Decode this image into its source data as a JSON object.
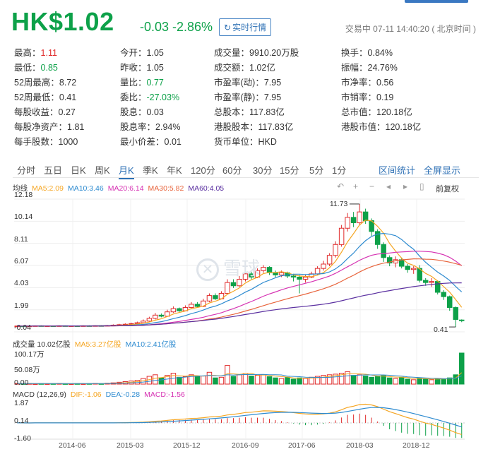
{
  "header": {
    "price": "HK$1.02",
    "change": "-0.03 -2.86%",
    "realtime_button": "实时行情",
    "realtime_icon": "refresh-icon",
    "trade_status": "交易中 07-11 14:40:20 ( 北京时间 )"
  },
  "stats": [
    [
      {
        "label": "最高：",
        "value": "1.11",
        "color": "red"
      },
      {
        "label": "今开：",
        "value": "1.05"
      },
      {
        "label": "成交量：",
        "value": "9910.20万股"
      },
      {
        "label": "换手：",
        "value": "0.84%"
      }
    ],
    [
      {
        "label": "最低：",
        "value": "0.85",
        "color": "green"
      },
      {
        "label": "昨收：",
        "value": "1.05"
      },
      {
        "label": "成交额：",
        "value": "1.02亿"
      },
      {
        "label": "振幅：",
        "value": "24.76%"
      }
    ],
    [
      {
        "label": "52周最高：",
        "value": "8.72"
      },
      {
        "label": "量比：",
        "value": "0.77",
        "color": "green"
      },
      {
        "label": "市盈率(动)：",
        "value": "7.95"
      },
      {
        "label": "市净率：",
        "value": "0.56"
      }
    ],
    [
      {
        "label": "52周最低：",
        "value": "0.41"
      },
      {
        "label": "委比：",
        "value": "-27.03%",
        "color": "green"
      },
      {
        "label": "市盈率(静)：",
        "value": "7.95"
      },
      {
        "label": "市销率：",
        "value": "0.19"
      }
    ],
    [
      {
        "label": "每股收益：",
        "value": "0.27"
      },
      {
        "label": "股息：",
        "value": "0.03"
      },
      {
        "label": "总股本：",
        "value": "117.83亿"
      },
      {
        "label": "总市值：",
        "value": "120.18亿"
      }
    ],
    [
      {
        "label": "每股净资产：",
        "value": "1.81"
      },
      {
        "label": "股息率：",
        "value": "2.94%"
      },
      {
        "label": "港股股本：",
        "value": "117.83亿"
      },
      {
        "label": "港股市值：",
        "value": "120.18亿"
      }
    ],
    [
      {
        "label": "每手股数：",
        "value": "1000"
      },
      {
        "label": "最小价差：",
        "value": "0.01"
      },
      {
        "label": "货币单位：",
        "value": "HKD"
      }
    ]
  ],
  "tabs": [
    "分时",
    "五日",
    "日K",
    "周K",
    "月K",
    "季K",
    "年K",
    "120分",
    "60分",
    "30分",
    "15分",
    "5分",
    "1分"
  ],
  "active_tab": "月K",
  "tab_right": [
    "区间统计",
    "全屏显示"
  ],
  "controls": {
    "icons": [
      "undo-icon",
      "zoom-in-icon",
      "zoom-out-icon",
      "scroll-left-icon",
      "scroll-right-icon",
      "switch-icon"
    ],
    "adjust_label": "前复权"
  },
  "watermark": "雪球",
  "colors": {
    "up": "#e02b2b",
    "down": "#0da149",
    "ma5": "#f5a623",
    "ma10": "#2e8bd0",
    "ma20": "#d633b3",
    "ma30": "#e8643c",
    "ma60": "#5a2fa0"
  },
  "chart_data": [
    {
      "type": "candlestick",
      "title": "",
      "legend": [
        {
          "label": "均线",
          "color": "#333"
        },
        {
          "label": "MA5:2.09",
          "color": "#f5a623"
        },
        {
          "label": "MA10:3.46",
          "color": "#2e8bd0"
        },
        {
          "label": "MA20:6.14",
          "color": "#d633b3"
        },
        {
          "label": "MA30:5.82",
          "color": "#e8643c"
        },
        {
          "label": "MA60:4.05",
          "color": "#5a2fa0"
        }
      ],
      "y_ticks": [
        "12.18",
        "10.14",
        "8.11",
        "6.07",
        "4.03",
        "1.99",
        "-0.04"
      ],
      "ylim": [
        -0.04,
        12.18
      ],
      "annotations": [
        {
          "label": "11.73",
          "kind": "max"
        },
        {
          "label": "0.41",
          "kind": "min"
        }
      ],
      "x_ticks": [
        "2014-06",
        "2015-03",
        "2015-12",
        "2016-09",
        "2017-06",
        "2018-03",
        "2018-12"
      ],
      "candles": [
        [
          0.45,
          0.5,
          0.4,
          0.52
        ],
        [
          0.5,
          0.48,
          0.44,
          0.53
        ],
        [
          0.48,
          0.5,
          0.45,
          0.54
        ],
        [
          0.5,
          0.52,
          0.47,
          0.55
        ],
        [
          0.52,
          0.5,
          0.46,
          0.56
        ],
        [
          0.5,
          0.51,
          0.47,
          0.55
        ],
        [
          0.51,
          0.5,
          0.46,
          0.54
        ],
        [
          0.5,
          0.52,
          0.47,
          0.56
        ],
        [
          0.52,
          0.5,
          0.46,
          0.55
        ],
        [
          0.5,
          0.51,
          0.47,
          0.54
        ],
        [
          0.51,
          0.5,
          0.46,
          0.55
        ],
        [
          0.5,
          0.52,
          0.48,
          0.56
        ],
        [
          0.52,
          0.51,
          0.47,
          0.56
        ],
        [
          0.51,
          0.53,
          0.48,
          0.57
        ],
        [
          0.53,
          0.52,
          0.48,
          0.58
        ],
        [
          0.52,
          0.55,
          0.49,
          0.6
        ],
        [
          0.55,
          0.58,
          0.52,
          0.65
        ],
        [
          0.58,
          0.62,
          0.55,
          0.7
        ],
        [
          0.62,
          0.66,
          0.58,
          0.75
        ],
        [
          0.66,
          0.72,
          0.62,
          0.8
        ],
        [
          0.72,
          0.8,
          0.68,
          0.9
        ],
        [
          0.8,
          0.95,
          0.76,
          1.1
        ],
        [
          0.95,
          1.2,
          0.9,
          1.35
        ],
        [
          1.2,
          1.5,
          1.1,
          1.7
        ],
        [
          1.5,
          1.4,
          1.3,
          1.65
        ],
        [
          1.4,
          1.8,
          1.35,
          2.0
        ],
        [
          1.8,
          2.1,
          1.7,
          2.3
        ],
        [
          2.1,
          1.9,
          1.8,
          2.2
        ],
        [
          1.9,
          2.2,
          1.85,
          2.4
        ],
        [
          2.2,
          2.5,
          2.1,
          2.7
        ],
        [
          2.5,
          2.3,
          2.2,
          2.7
        ],
        [
          2.3,
          2.8,
          2.25,
          3.0
        ],
        [
          2.8,
          3.3,
          2.7,
          3.5
        ],
        [
          3.3,
          3.0,
          2.9,
          3.5
        ],
        [
          3.0,
          3.5,
          2.95,
          3.7
        ],
        [
          3.5,
          4.5,
          3.4,
          4.8
        ],
        [
          4.5,
          4.2,
          4.0,
          4.8
        ],
        [
          4.2,
          4.8,
          4.1,
          5.1
        ],
        [
          4.8,
          5.3,
          4.6,
          5.6
        ],
        [
          5.3,
          5.0,
          4.8,
          5.5
        ],
        [
          5.0,
          5.6,
          4.9,
          5.8
        ],
        [
          5.6,
          5.9,
          5.4,
          6.1
        ],
        [
          5.9,
          5.4,
          5.2,
          6.0
        ],
        [
          5.4,
          5.2,
          5.0,
          5.6
        ],
        [
          5.2,
          5.4,
          5.0,
          5.6
        ],
        [
          5.4,
          5.1,
          4.9,
          5.5
        ],
        [
          5.1,
          5.0,
          4.6,
          5.3
        ],
        [
          5.0,
          4.8,
          3.5,
          5.2
        ],
        [
          4.8,
          5.0,
          4.5,
          5.2
        ],
        [
          5.0,
          5.3,
          4.9,
          5.5
        ],
        [
          5.3,
          5.8,
          5.2,
          6.0
        ],
        [
          5.8,
          6.2,
          5.6,
          6.5
        ],
        [
          6.2,
          7.0,
          6.0,
          7.2
        ],
        [
          7.0,
          8.0,
          6.8,
          8.3
        ],
        [
          8.0,
          9.5,
          7.8,
          9.8
        ],
        [
          9.5,
          10.5,
          9.2,
          10.9
        ],
        [
          10.5,
          10.0,
          9.6,
          11.0
        ],
        [
          10.0,
          11.0,
          9.8,
          11.73
        ],
        [
          11.0,
          10.2,
          9.9,
          11.3
        ],
        [
          10.2,
          9.2,
          8.8,
          10.4
        ],
        [
          9.2,
          8.0,
          7.6,
          9.4
        ],
        [
          8.0,
          6.8,
          6.4,
          8.2
        ],
        [
          6.8,
          6.3,
          6.0,
          7.0
        ],
        [
          6.3,
          6.6,
          5.9,
          6.9
        ],
        [
          6.6,
          6.0,
          5.8,
          6.8
        ],
        [
          6.0,
          5.7,
          5.4,
          6.2
        ],
        [
          5.7,
          5.8,
          5.3,
          6.0
        ],
        [
          5.8,
          4.7,
          4.5,
          6.1
        ],
        [
          4.7,
          4.5,
          4.2,
          4.9
        ],
        [
          4.5,
          4.6,
          4.1,
          4.9
        ],
        [
          4.6,
          3.6,
          3.4,
          4.7
        ],
        [
          3.6,
          3.2,
          2.9,
          3.8
        ],
        [
          3.2,
          2.2,
          1.9,
          3.3
        ],
        [
          2.2,
          1.1,
          0.41,
          2.3
        ],
        [
          1.05,
          1.02,
          0.85,
          1.11
        ]
      ],
      "ma": {
        "ma5": {
          "last": 2.09
        },
        "ma10": {
          "last": 3.46
        },
        "ma20": {
          "last": 6.14
        },
        "ma30": {
          "last": 5.82
        },
        "ma60": {
          "last": 4.05
        }
      }
    },
    {
      "type": "bar",
      "title": "",
      "legend": [
        {
          "label": "成交量 10.02亿股",
          "color": "#333"
        },
        {
          "label": "MA5:3.27亿股",
          "color": "#f5a623"
        },
        {
          "label": "MA10:2.41亿股",
          "color": "#2e8bd0"
        }
      ],
      "y_ticks": [
        "100.17万",
        "50.08万",
        "0.00"
      ],
      "ylim": [
        0,
        100.17
      ],
      "values": [
        2,
        1.5,
        1.8,
        1.2,
        1.6,
        1.3,
        1.5,
        1.9,
        1.4,
        1.2,
        1.6,
        1.3,
        1.7,
        2.2,
        1.5,
        2.8,
        4,
        6,
        8,
        10,
        12,
        18,
        25,
        30,
        20,
        28,
        35,
        22,
        24,
        30,
        25,
        26,
        38,
        20,
        22,
        60,
        25,
        30,
        34,
        26,
        28,
        30,
        24,
        20,
        18,
        22,
        16,
        20,
        18,
        22,
        25,
        28,
        30,
        32,
        35,
        40,
        28,
        30,
        26,
        22,
        24,
        28,
        20,
        18,
        22,
        16,
        14,
        20,
        16,
        14,
        18,
        16,
        20,
        30,
        100
      ]
    },
    {
      "type": "bar",
      "title": "",
      "legend": [
        {
          "label": "MACD (12,26,9)",
          "color": "#333"
        },
        {
          "label": "DIF:-1.06",
          "color": "#f5a623"
        },
        {
          "label": "DEA:-0.28",
          "color": "#2e8bd0"
        },
        {
          "label": "MACD:-1.56",
          "color": "#d633b3"
        }
      ],
      "y_ticks": [
        "1.87",
        "0.14",
        "-1.60"
      ],
      "ylim": [
        -1.6,
        1.87
      ]
    }
  ]
}
